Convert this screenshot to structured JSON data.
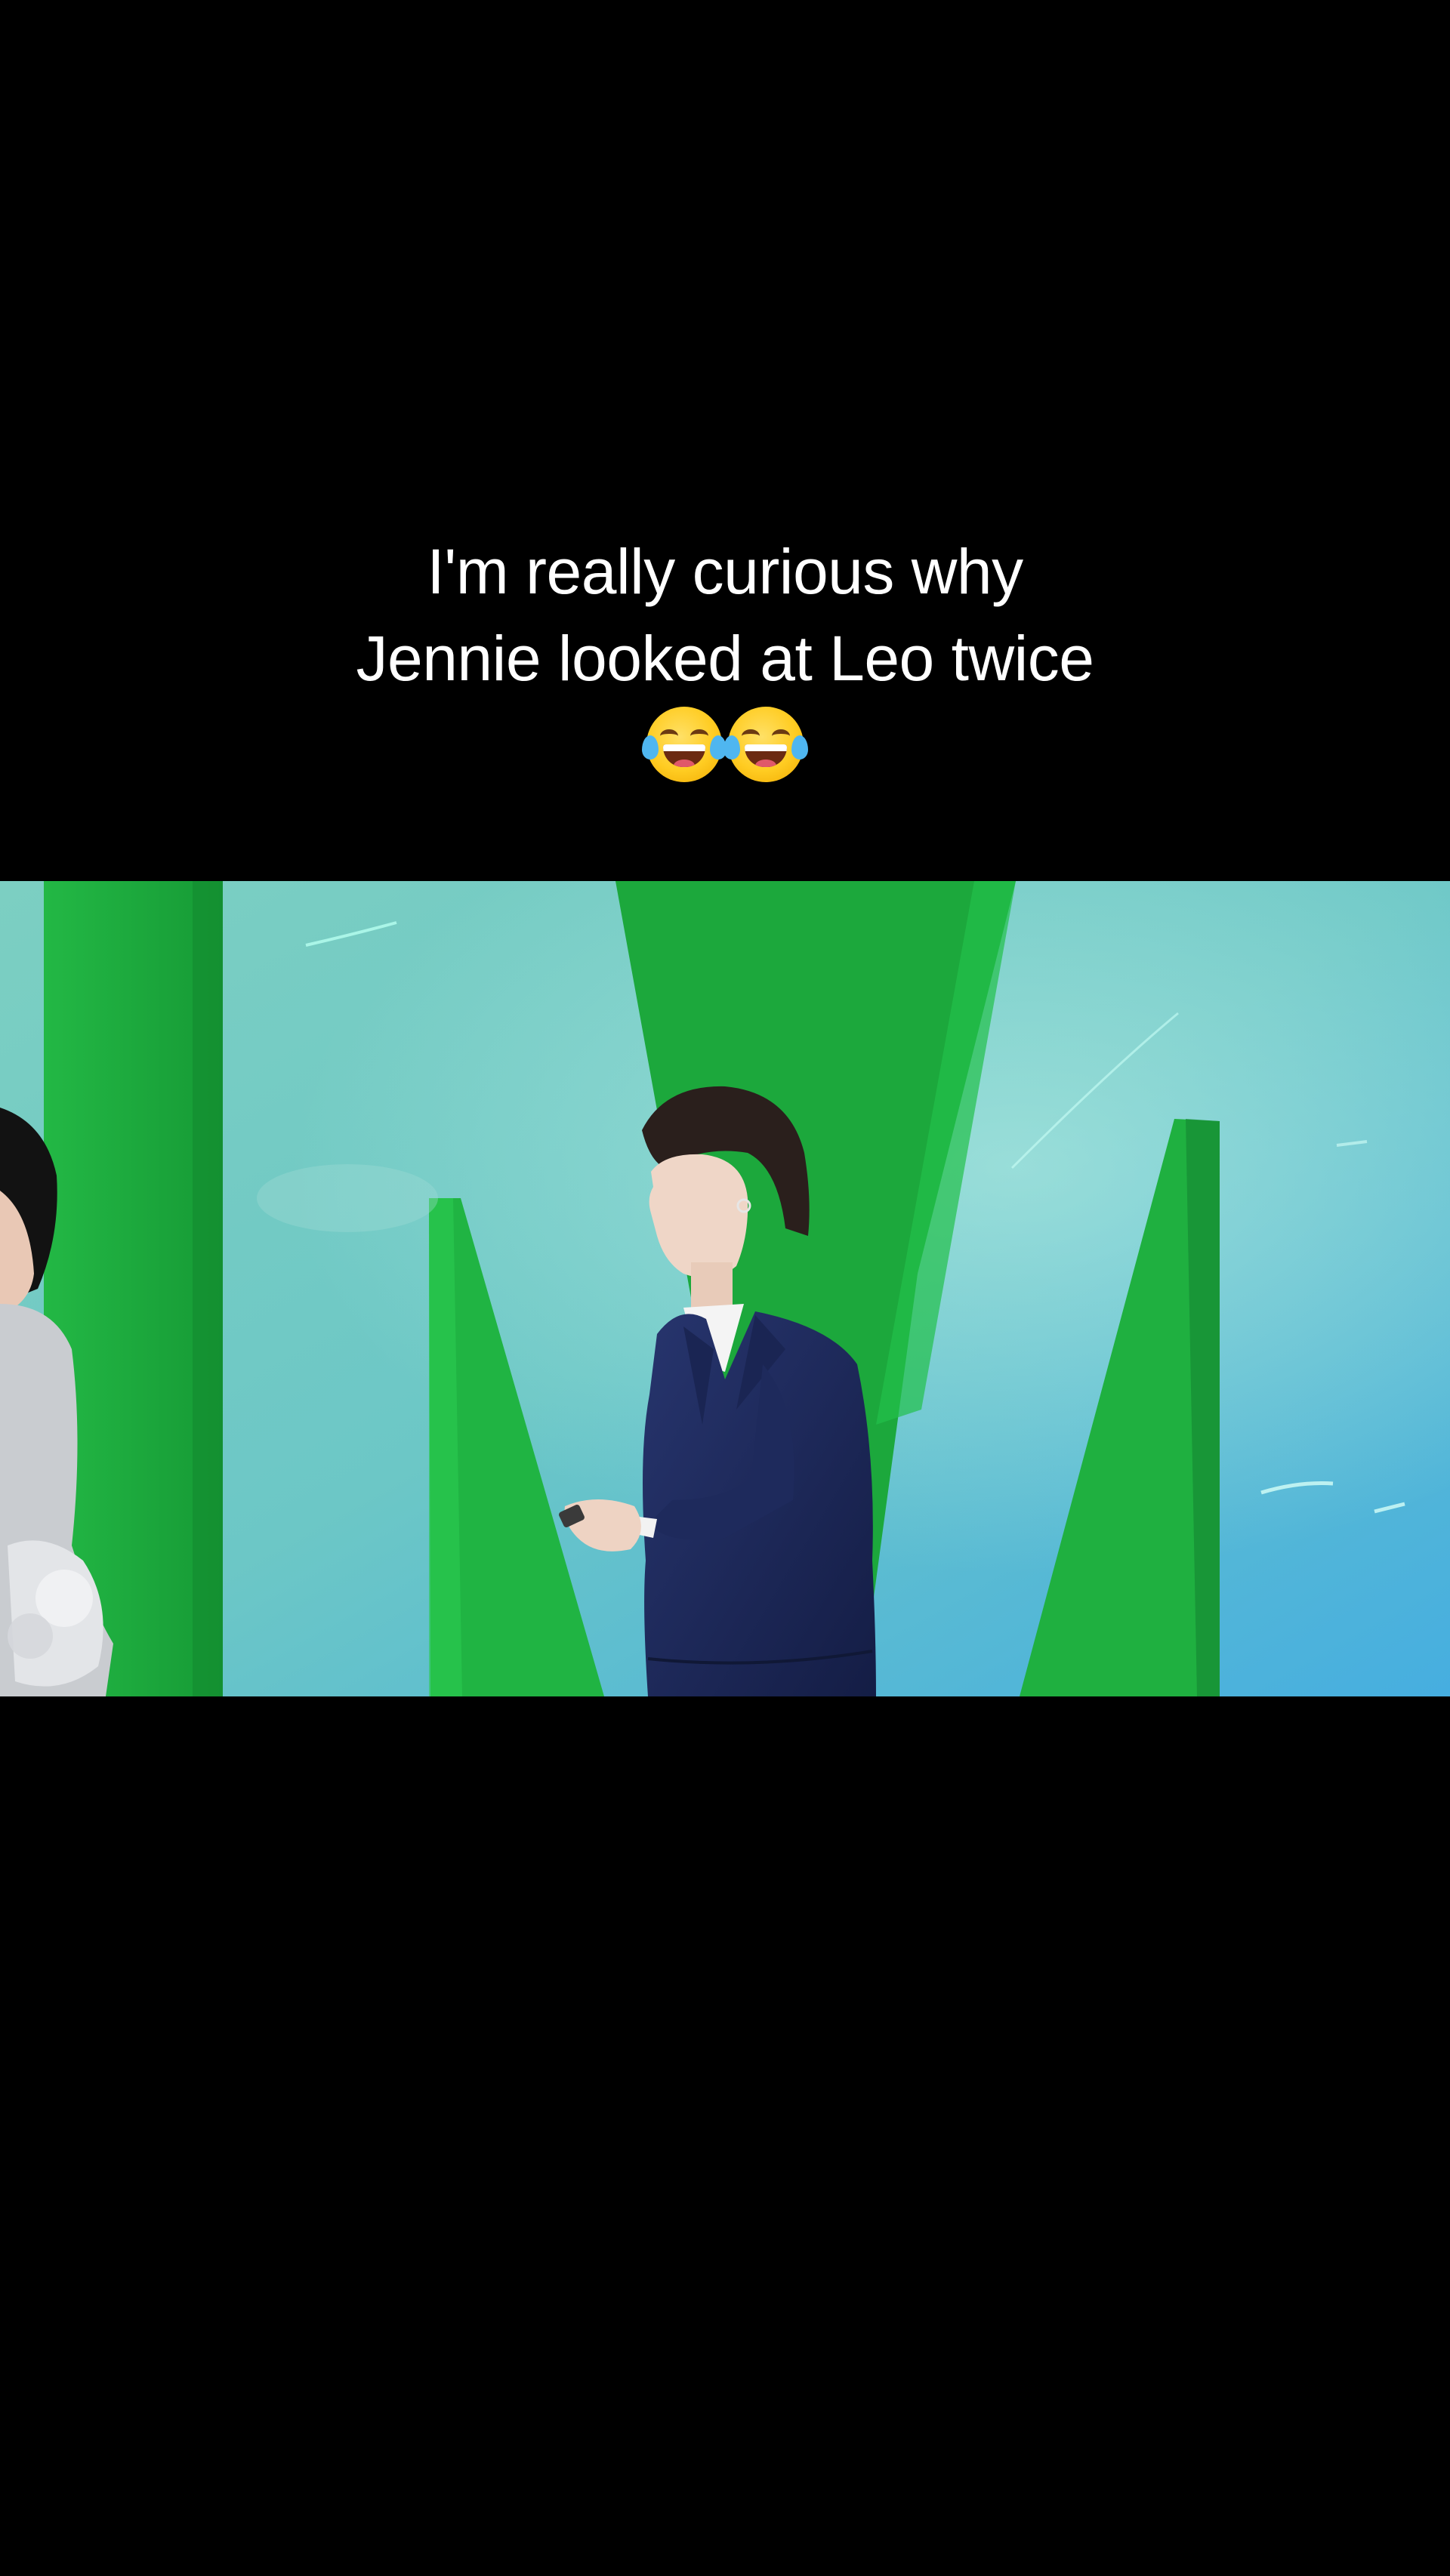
{
  "caption": {
    "line1": "I'm really curious why",
    "line2": "Jennie looked at Leo twice",
    "emojis": [
      "face-with-tears-of-joy-icon",
      "face-with-tears-of-joy-icon"
    ]
  },
  "colors": {
    "background": "#000000",
    "caption_text": "#ffffff",
    "stage_green": "#1fb53f",
    "stage_cyan": "#6fc9c9",
    "suit_navy": "#1e2a5c"
  }
}
